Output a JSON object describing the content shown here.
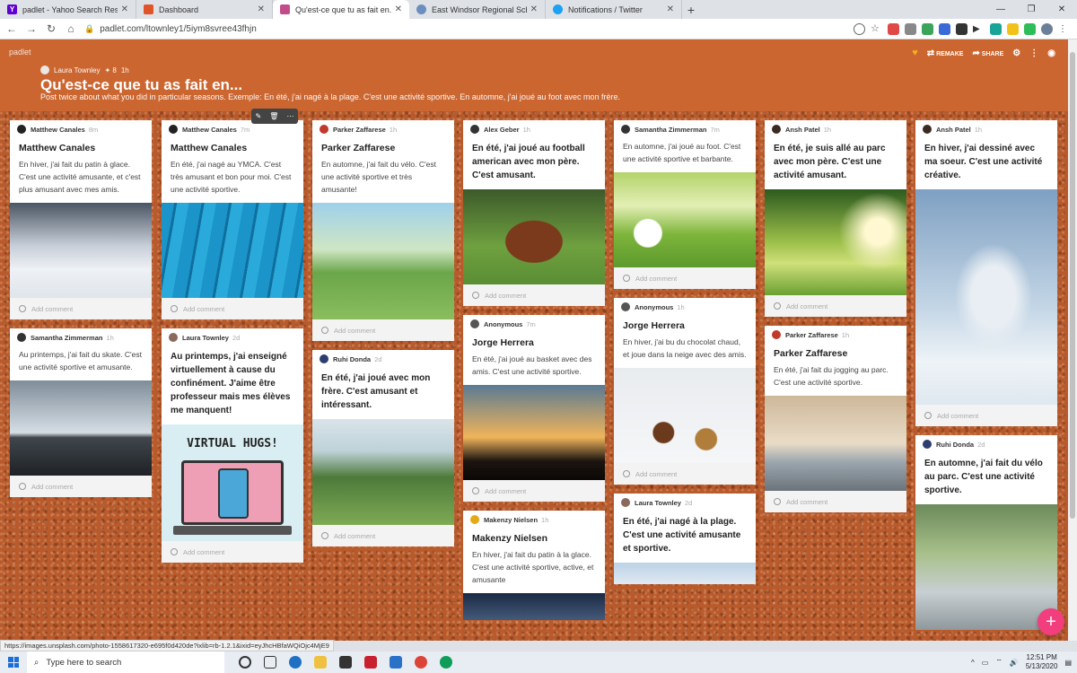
{
  "browser": {
    "tabs": [
      {
        "title": "padlet - Yahoo Search Results",
        "color": "#6001d2",
        "glyph": "Y"
      },
      {
        "title": "Dashboard",
        "color": "#e0542a",
        "glyph": "■"
      },
      {
        "title": "Qu'est-ce que tu as fait en...",
        "color": "#c04c8c",
        "glyph": "■"
      },
      {
        "title": "East Windsor Regional School Di",
        "color": "#6c8ebf",
        "glyph": "●"
      },
      {
        "title": "Notifications / Twitter",
        "color": "#1da1f2",
        "glyph": "●"
      }
    ],
    "url": "padlet.com/ltownley1/5iym8svree43fhjn"
  },
  "padlet": {
    "logo": "padlet",
    "author": "Laura Townley",
    "karma": "✦ 8",
    "time": "1h",
    "title": "Qu'est-ce que tu as fait en...",
    "description": "Post twice about what you did in particular seasons. Exemple: En été, j'ai nagé à la plage. C'est une activité sportive. En automne, j'ai joué au foot avec mon frère.",
    "remake": "REMAKE",
    "share": "SHARE"
  },
  "add_comment": "Add comment",
  "hugs_text": "VIRTUAL HUGS!",
  "posts": {
    "c1p1": {
      "author": "Matthew Canales",
      "time": "8m",
      "title": "Matthew Canales",
      "body": "En hiver, j'ai fait du patin à glace. C'est une activité amusante, et c'est plus amusant avec mes amis."
    },
    "c1p2": {
      "author": "Samantha Zimmerman",
      "time": "1h",
      "body": "Au printemps, j'ai fait du skate. C'est une activité sportive et amusante."
    },
    "c2p1": {
      "author": "Matthew Canales",
      "time": "7m",
      "title": "Matthew Canales",
      "body": "En été, j'ai nagé au YMCA. C'est très amusant et bon pour moi. C'est une activité sportive."
    },
    "c2p2": {
      "author": "Laura Townley",
      "time": "2d",
      "body": "Au printemps, j'ai enseigné virtuellement à cause du confinément.  J'aime être professeur mais mes élèves me manquent!"
    },
    "c3p1": {
      "author": "Parker Zaffarese",
      "time": "1h",
      "title": "Parker Zaffarese",
      "body": "En automne, j'ai fait du vélo. C'est une activité sportive et très amusante!"
    },
    "c3p2": {
      "author": "Ruhi Donda",
      "time": "2d",
      "body": "En été, j'ai joué avec mon frère. C'est amusant et intéressant."
    },
    "c4p1": {
      "author": "Alex Geber",
      "time": "1h",
      "body": "En été, j'ai joué au football american avec mon père. C'est amusant."
    },
    "c4p2": {
      "author": "Anonymous",
      "time": "7m",
      "title": "Jorge Herrera",
      "body": "En été, j'ai joué au basket avec des amis. C'est une activité sportive."
    },
    "c4p3": {
      "author": "Makenzy Nielsen",
      "time": "1h",
      "title": "Makenzy Nielsen",
      "body": "En hiver, j'ai fait du patin à la glace. C'est une activité sportive, active, et amusante"
    },
    "c5p1": {
      "author": "Samantha Zimmerman",
      "time": "7m",
      "body": "En automne, j'ai joué au foot. C'est une activité sportive et barbante."
    },
    "c5p2": {
      "author": "Anonymous",
      "time": "1h",
      "title": "Jorge Herrera",
      "body": "En hiver, j'ai bu du chocolat chaud, et joue dans la neige avec des amis."
    },
    "c5p3": {
      "author": "Laura Townley",
      "time": "2d",
      "body": "En été, j'ai nagé à la plage. C'est une activité amusante et sportive."
    },
    "c6p1": {
      "author": "Ansh Patel",
      "time": "1h",
      "body": "En été, je suis allé au parc avec mon père. C'est une activité amusant."
    },
    "c6p2": {
      "author": "Parker Zaffarese",
      "time": "1h",
      "title": "Parker Zaffarese",
      "body": "En été, j'ai fait du jogging au parc. C'est une activité sportive."
    },
    "c7p1": {
      "author": "Ansh Patel",
      "time": "1h",
      "body": "En hiver, j'ai dessiné avec ma soeur. C'est une activité créative."
    },
    "c7p2": {
      "author": "Ruhi Donda",
      "time": "2d",
      "body": "En automne, j'ai fait du vélo au parc. C'est une activité sportive."
    }
  },
  "status_url": "https://images.unsplash.com/photo-1558617320-e695f0d420de?ixlib=rb-1.2.1&ixid=eyJhcHBfaWQiOjc4MjE9",
  "taskbar": {
    "search_placeholder": "Type here to search",
    "time": "12:51 PM",
    "date": "5/13/2020"
  }
}
